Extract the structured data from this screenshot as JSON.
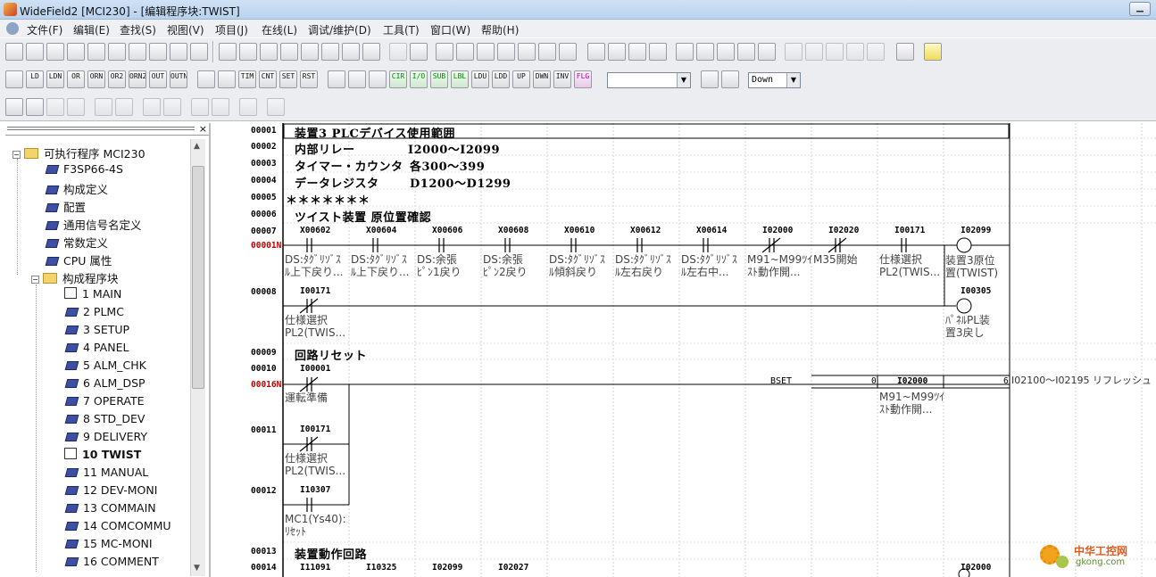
{
  "window": {
    "title": "WideField2 [MCI230] - [编辑程序块:TWIST]",
    "minimize": "▁"
  },
  "menu": [
    "文件(F)",
    "编辑(E)",
    "查找(S)",
    "视图(V)",
    "项目(J)",
    "在线(L)",
    "调试/维护(D)",
    "工具(T)",
    "窗口(W)",
    "帮助(H)"
  ],
  "toolbar2": {
    "buttons": [
      "LD",
      "LDN",
      "OR",
      "ORN",
      "OR2",
      "ORN2",
      "OUT",
      "OUTN",
      "TIM",
      "CNT",
      "SET",
      "RST",
      "CIR",
      "I/O",
      "SUB",
      "LBL",
      "LDU",
      "LDD",
      "UP",
      "DWN",
      "INV",
      "FLG"
    ],
    "search_value": "",
    "direction": "Down"
  },
  "tree": {
    "close_label": "×",
    "items": [
      {
        "label": "可执行程序 MCI230",
        "type": "folder"
      },
      {
        "label": "F3SP66-4S",
        "type": "book"
      },
      {
        "label": "构成定义",
        "type": "book"
      },
      {
        "label": "配置",
        "type": "book"
      },
      {
        "label": "通用信号名定义",
        "type": "book"
      },
      {
        "label": "常数定义",
        "type": "book"
      },
      {
        "label": "CPU 属性",
        "type": "book"
      },
      {
        "label": "构成程序块",
        "type": "folder"
      },
      {
        "label": "1 MAIN",
        "type": "doc"
      },
      {
        "label": "2 PLMC",
        "type": "book"
      },
      {
        "label": "3 SETUP",
        "type": "book"
      },
      {
        "label": "4 PANEL",
        "type": "book"
      },
      {
        "label": "5 ALM_CHK",
        "type": "book"
      },
      {
        "label": "6 ALM_DSP",
        "type": "book"
      },
      {
        "label": "7 OPERATE",
        "type": "book"
      },
      {
        "label": "8 STD_DEV",
        "type": "book"
      },
      {
        "label": "9 DELIVERY",
        "type": "book"
      },
      {
        "label": "10 TWIST",
        "type": "doc",
        "active": true
      },
      {
        "label": "11 MANUAL",
        "type": "book"
      },
      {
        "label": "12 DEV-MONI",
        "type": "book"
      },
      {
        "label": "13 COMMAIN",
        "type": "book"
      },
      {
        "label": "14 COMCOMMU",
        "type": "book"
      },
      {
        "label": "15 MC-MONI",
        "type": "book"
      },
      {
        "label": "16 COMMENT",
        "type": "book"
      }
    ]
  },
  "ladder": {
    "line_numbers": [
      "00001",
      "00002",
      "00003",
      "00004",
      "00005",
      "00006",
      "00007",
      "00001N",
      "00008",
      "00009",
      "00010",
      "00016N",
      "00011",
      "00012",
      "00013",
      "00014"
    ],
    "comments": {
      "l1": "装置3  PLCデバイス使用範囲",
      "l2a": "内部リレー",
      "l2b": "I2000～I2099",
      "l3a": "タイマー・カウンタ",
      "l3b": "各300～399",
      "l4a": "データレジスタ",
      "l4b": "D1200～D1299",
      "l5": "＊＊＊＊＊＊＊",
      "l6": "ツイスト装置  原位置確認",
      "l9": "回路リセット",
      "l13": "装置動作回路"
    },
    "rung7_contacts": [
      {
        "addr": "X00602",
        "desc1": "DS:ﾀｸﾞﾘｿﾞｽ",
        "desc2": "ﾙ上下戻り..."
      },
      {
        "addr": "X00604",
        "desc1": "DS:ﾀｸﾞﾘｿﾞｽ",
        "desc2": "ﾙ上下戻り..."
      },
      {
        "addr": "X00606",
        "desc1": "DS:余張",
        "desc2": "ﾋﾟﾝ1戻り"
      },
      {
        "addr": "X00608",
        "desc1": "DS:余張",
        "desc2": "ﾋﾟﾝ2戻り"
      },
      {
        "addr": "X00610",
        "desc1": "DS:ﾀｸﾞﾘｿﾞｽ",
        "desc2": "ﾙ傾斜戻り"
      },
      {
        "addr": "X00612",
        "desc1": "DS:ﾀｸﾞﾘｿﾞｽ",
        "desc2": "ﾙ左右戻り"
      },
      {
        "addr": "X00614",
        "desc1": "DS:ﾀｸﾞﾘｿﾞｽ",
        "desc2": "ﾙ左右中..."
      },
      {
        "addr": "I02000",
        "desc1": "M91~M99ﾂｲ",
        "desc2": "ｽﾄ動作開..."
      },
      {
        "addr": "I02020",
        "desc1": "M35開始",
        "desc2": ""
      },
      {
        "addr": "I00171",
        "desc1": "仕様選択",
        "desc2": "PL2(TWIS..."
      }
    ],
    "rung7_coil": {
      "addr": "I02099",
      "desc1": "装置3原位",
      "desc2": "置(TWIST)"
    },
    "rung8_contact": {
      "addr": "I00171",
      "desc1": "仕様選択",
      "desc2": "PL2(TWIS..."
    },
    "rung8_coil": {
      "addr": "I00305",
      "desc1": "ﾊﾟﾈﾙPL装",
      "desc2": "置3戻し"
    },
    "rung10_contact": {
      "addr": "I00001",
      "desc1": "運転準備"
    },
    "rung10_instr": {
      "name": "BSET",
      "p1": "0",
      "p2": "I02000",
      "p3": "6",
      "p2_desc1": "M91~M99ﾂｲ",
      "p2_desc2": "ｽﾄ動作開..."
    },
    "rung10_right_comment": "I02100～I02195 リフレッシュ",
    "rung11_contact": {
      "addr": "I00171",
      "desc1": "仕様選択",
      "desc2": "PL2(TWIS..."
    },
    "rung12_contact": {
      "addr": "I10307",
      "desc1": "MC1(Ys40):",
      "desc2": "ﾘｾｯﾄ"
    },
    "rung14_addrs": [
      "I11091",
      "I10325",
      "I02099",
      "I02027"
    ],
    "rung14_coil": "I02000"
  },
  "watermark": {
    "line1": "中华工控网",
    "line2": "gkong.com"
  }
}
